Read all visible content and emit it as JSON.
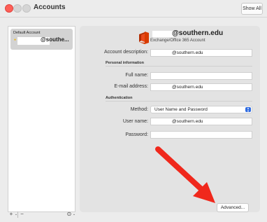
{
  "window": {
    "title": "Accounts",
    "show_all_label": "Show All"
  },
  "sidebar": {
    "account_type": "Default Account",
    "account_name": "@southe..."
  },
  "sidebar_toolbar": {
    "add_label": "+",
    "remove_label": "−",
    "chevron": "⌄",
    "options_icon": "⊙"
  },
  "header": {
    "email": "@southern.edu",
    "account_kind": "Exchange/Office 365 Account"
  },
  "form": {
    "account_description_label": "Account description:",
    "account_description_value": "@southern.edu",
    "personal_info_heading": "Personal information",
    "full_name_label": "Full name:",
    "full_name_value": "",
    "email_label": "E-mail address:",
    "email_value": "@southern.edu",
    "authentication_heading": "Authentication",
    "method_label": "Method:",
    "method_value": "User Name and Password",
    "username_label": "User name:",
    "username_value": "@southern.edu",
    "password_label": "Password:",
    "password_value": ""
  },
  "advanced_label": "Advanced...",
  "colors": {
    "arrow": "#f0281c",
    "select_accent": "#2f6be0",
    "office_logo": "#d83b01"
  }
}
